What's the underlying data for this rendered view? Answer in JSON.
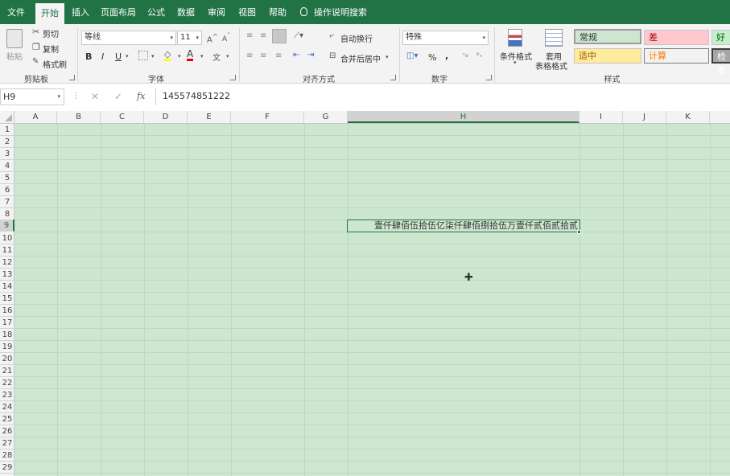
{
  "tabs": [
    "文件",
    "开始",
    "插入",
    "页面布局",
    "公式",
    "数据",
    "审阅",
    "视图",
    "帮助"
  ],
  "tell_me": "操作说明搜索",
  "clipboard": {
    "paste": "粘贴",
    "cut": "剪切",
    "copy": "复制",
    "format_painter": "格式刷",
    "group": "剪贴板"
  },
  "font": {
    "name": "等线",
    "size": "11",
    "bold": "B",
    "italic": "I",
    "underline": "U",
    "group": "字体"
  },
  "alignment": {
    "wrap": "自动换行",
    "merge": "合并后居中",
    "group": "对齐方式"
  },
  "number": {
    "format": "特殊",
    "percent": "%",
    "comma": ",",
    "group": "数字"
  },
  "styles": {
    "conditional": "条件格式",
    "table_line1": "套用",
    "table_line2": "表格格式",
    "normal": "常规",
    "bad": "差",
    "good": "好",
    "neutral": "适中",
    "calculation": "计算",
    "check": "检查",
    "group": "样式"
  },
  "formula_bar": {
    "name_box": "H9",
    "fx": "fx",
    "value": "145574851222"
  },
  "columns": [
    "A",
    "B",
    "C",
    "D",
    "E",
    "F",
    "G",
    "H",
    "I",
    "J",
    "K"
  ],
  "rows": [
    "1",
    "2",
    "3",
    "4",
    "5",
    "6",
    "7",
    "8",
    "9",
    "10",
    "11",
    "12",
    "13",
    "14",
    "15",
    "16",
    "17",
    "18",
    "19",
    "20",
    "21",
    "22",
    "23",
    "24",
    "25",
    "26",
    "27",
    "28",
    "29"
  ],
  "active_cell": {
    "ref": "H9",
    "display": "壹仟肆佰伍拾伍亿柒仟肆佰捌拾伍万壹仟贰佰贰拾贰"
  },
  "colors": {
    "accent": "#217346",
    "sheet_bg": "#cde6d0",
    "bad_bg": "#ffc7ce",
    "good_bg": "#c6efce",
    "neutral_bg": "#ffeb9c"
  }
}
